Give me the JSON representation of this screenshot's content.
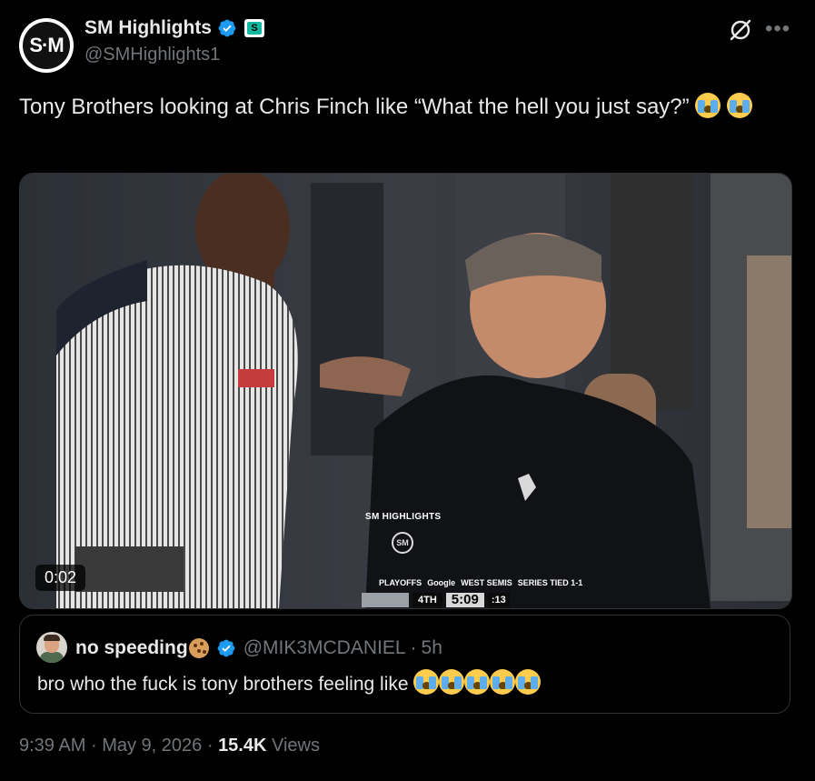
{
  "author": {
    "avatar_text": "S·M",
    "display_name": "SM Highlights",
    "handle": "@SMHighlights1",
    "affiliate_badge_text": "S"
  },
  "tweet": {
    "text": "Tony Brothers looking at Chris Finch like “What the hell you just say?”",
    "emoji_name": "loudly-crying-face"
  },
  "media": {
    "duration": "0:02",
    "watermark_text": "SM HIGHLIGHTS",
    "watermark_logo": "SM",
    "scoreboard": {
      "brand": "PLAYOFFS",
      "sponsor": "Google",
      "series_title": "WEST SEMIS",
      "series_status": "SERIES TIED 1-1",
      "quarter": "4TH",
      "clock": "5:09",
      "shot_clock": ":13"
    }
  },
  "quote": {
    "display_name": "no speeding",
    "name_emoji": "cookie",
    "handle": "@MIK3MCDANIEL",
    "separator": "·",
    "time": "5h",
    "text": "bro who the fuck is tony brothers feeling like",
    "emoji_count": 5
  },
  "meta": {
    "time": "9:39 AM",
    "sep1": "·",
    "date": "May 9, 2026",
    "sep2": "·",
    "views_count": "15.4K",
    "views_label": "Views"
  },
  "colors": {
    "background": "#000000",
    "text_primary": "#e7e9ea",
    "text_secondary": "#71767b",
    "verified_blue": "#1d9bf0",
    "border": "#2f3336"
  },
  "icons": [
    "verified-badge-icon",
    "affiliate-badge-icon",
    "grok-icon",
    "more-icon"
  ]
}
